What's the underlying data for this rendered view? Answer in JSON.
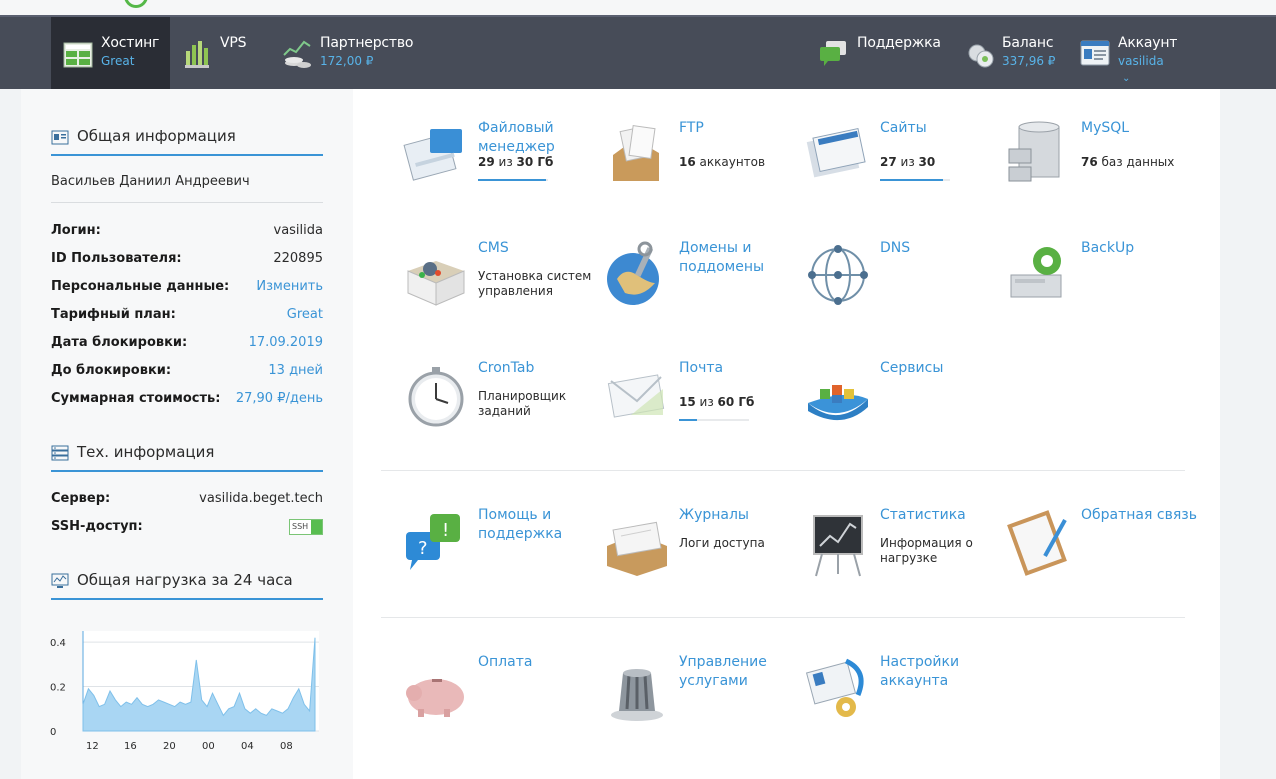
{
  "nav": {
    "hosting": {
      "label": "Хостинг",
      "sub": "Great"
    },
    "vps": {
      "label": "VPS"
    },
    "partner": {
      "label": "Партнерство",
      "sub": "172,00 ₽"
    },
    "support": {
      "label": "Поддержка"
    },
    "balance": {
      "label": "Баланс",
      "sub": "337,96 ₽"
    },
    "account": {
      "label": "Аккаунт",
      "sub": "vasilida"
    }
  },
  "sidebar": {
    "general_title": "Общая информация",
    "full_name": "Васильев Даниил Андреевич",
    "rows": [
      {
        "k": "Логин:",
        "v": "vasilida"
      },
      {
        "k": "ID Пользователя:",
        "v": "220895"
      },
      {
        "k": "Персональные данные:",
        "v": "Изменить"
      },
      {
        "k": "Тарифный план:",
        "v": "Great"
      },
      {
        "k": "Дата блокировки:",
        "v": "17.09.2019"
      },
      {
        "k": "До блокировки:",
        "v": "13 дней"
      },
      {
        "k": "Суммарная стоимость:",
        "v": "27,90 ₽/день"
      }
    ],
    "tech_title": "Тех. информация",
    "tech_rows": [
      {
        "k": "Сервер:",
        "v": "vasilida.beget.tech"
      },
      {
        "k": "SSH-доступ:",
        "v": "SSH"
      }
    ],
    "load_title": "Общая нагрузка за 24 часа"
  },
  "chart_data": {
    "type": "area",
    "title": "Общая нагрузка за 24 часа",
    "x_ticks": [
      "12",
      "16",
      "20",
      "00",
      "04",
      "08"
    ],
    "y_ticks": [
      "0.4",
      "0.2",
      "0"
    ],
    "ylim": [
      0,
      0.45
    ],
    "series": [
      {
        "values": [
          0.12,
          0.19,
          0.16,
          0.11,
          0.12,
          0.18,
          0.14,
          0.11,
          0.13,
          0.12,
          0.15,
          0.12,
          0.11,
          0.12,
          0.14,
          0.13,
          0.12,
          0.11,
          0.13,
          0.12,
          0.13,
          0.32,
          0.14,
          0.11,
          0.17,
          0.12,
          0.07,
          0.1,
          0.11,
          0.17,
          0.1,
          0.08,
          0.1,
          0.08,
          0.07,
          0.1,
          0.09,
          0.08,
          0.1,
          0.15,
          0.19,
          0.12,
          0.09,
          0.42
        ]
      }
    ],
    "grid": true,
    "color": "#a9d6f3"
  },
  "tiles": [
    {
      "title": "Файловый менеджер",
      "meta_b1": "29",
      "meta_mid": " из ",
      "meta_b2": "30 Гб",
      "progress": 0.97,
      "icon": "file-manager-icon"
    },
    {
      "title": "FTP",
      "meta_b1": "16",
      "meta_mid": " аккаунтов",
      "meta_b2": "",
      "icon": "ftp-icon"
    },
    {
      "title": "Сайты",
      "meta_b1": "27",
      "meta_mid": " из ",
      "meta_b2": "30",
      "progress": 0.9,
      "icon": "sites-icon"
    },
    {
      "title": "MySQL",
      "meta_b1": "76",
      "meta_mid": " баз данных",
      "meta_b2": "",
      "icon": "mysql-icon"
    },
    {
      "title": "CMS",
      "desc": "Установка систем управления",
      "icon": "cms-icon"
    },
    {
      "title": "Домены и поддомены",
      "icon": "domains-icon"
    },
    {
      "title": "DNS",
      "icon": "dns-icon"
    },
    {
      "title": "BackUp",
      "icon": "backup-icon"
    },
    {
      "title": "CronTab",
      "desc": "Планировщик заданий",
      "icon": "crontab-icon"
    },
    {
      "title": "Почта",
      "meta_b1": "15",
      "meta_mid": " из ",
      "meta_b2": "60 Гб",
      "progress": 0.25,
      "icon": "mail-icon"
    },
    {
      "title": "Сервисы",
      "icon": "services-icon"
    },
    {
      "title": "Помощь и поддержка",
      "icon": "help-icon"
    },
    {
      "title": "Журналы",
      "desc": "Логи доступа",
      "icon": "logs-icon"
    },
    {
      "title": "Статистика",
      "desc": "Информация о нагрузке",
      "icon": "stats-icon"
    },
    {
      "title": "Обратная связь",
      "icon": "feedback-icon"
    },
    {
      "title": "Оплата",
      "icon": "payment-icon"
    },
    {
      "title": "Управление услугами",
      "icon": "services-manage-icon"
    },
    {
      "title": "Настройки аккаунта",
      "icon": "account-settings-icon"
    }
  ]
}
